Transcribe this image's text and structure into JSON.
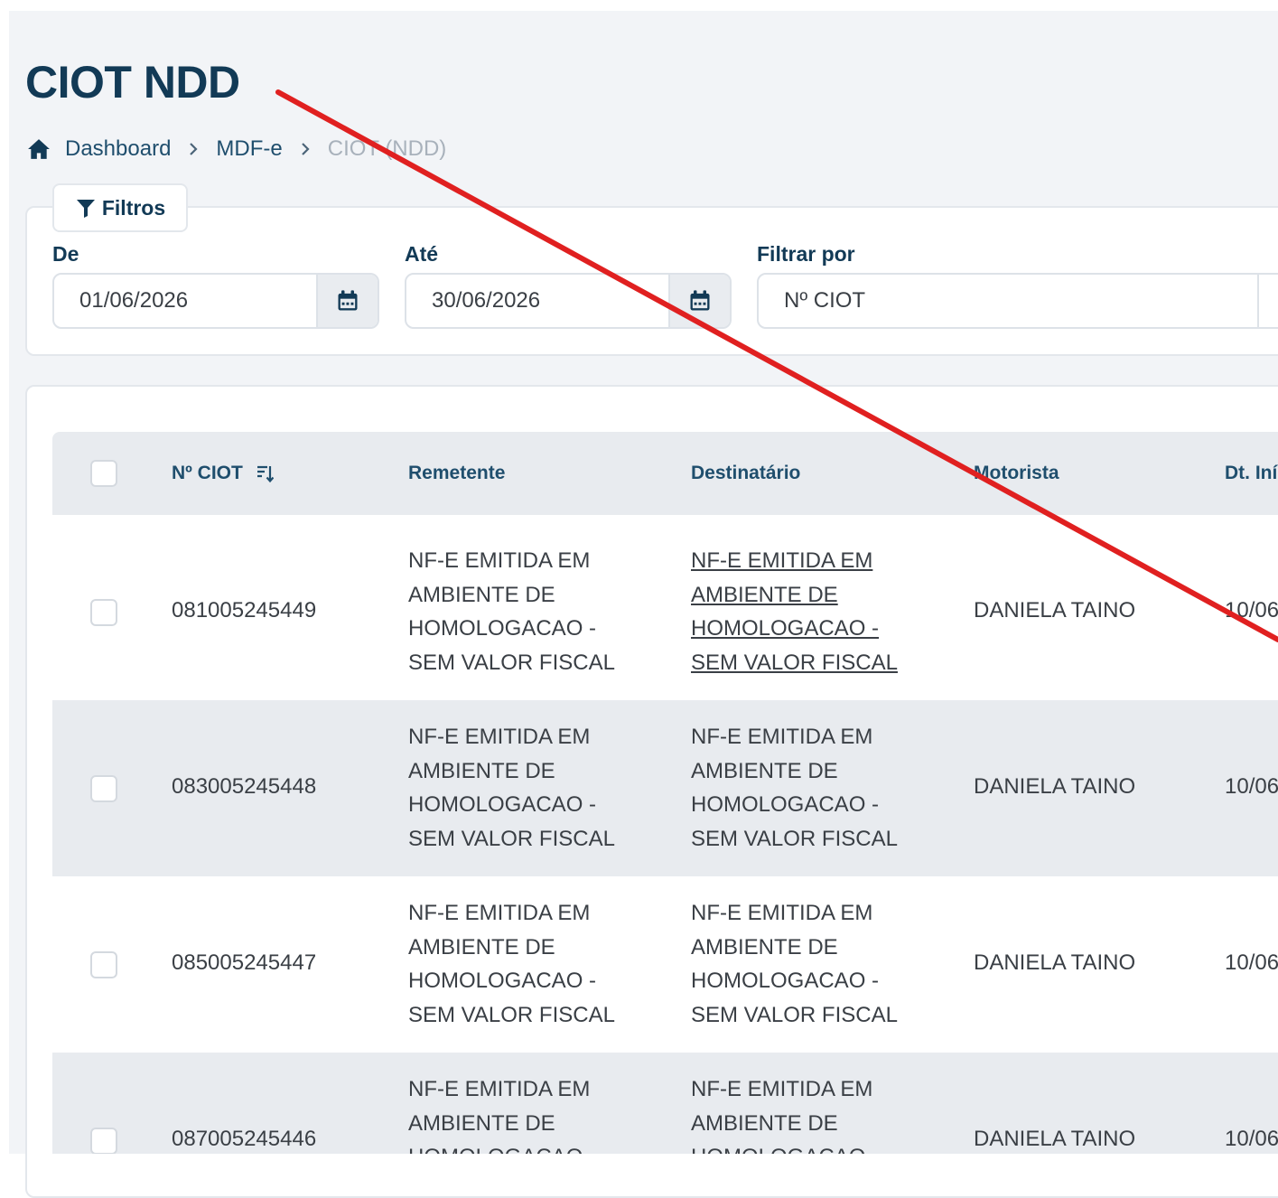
{
  "page": {
    "title": "CIOT NDD",
    "breadcrumb": {
      "items": [
        "Dashboard",
        "MDF-e"
      ],
      "current": "CIOT (NDD)"
    }
  },
  "filters": {
    "tab_label": "Filtros",
    "de": {
      "label": "De",
      "value": "01/06/2026"
    },
    "ate": {
      "label": "Até",
      "value": "30/06/2026"
    },
    "filtrar_por": {
      "label": "Filtrar por",
      "value": "Nº CIOT"
    }
  },
  "table": {
    "columns": {
      "ciot": "Nº CIOT",
      "remetente": "Remetente",
      "destinatario": "Destinatário",
      "motorista": "Motorista",
      "dt_inicio": "Dt. Iní"
    },
    "rows": [
      {
        "ciot": "081005245449",
        "remetente": "NF-E EMITIDA EM AMBIENTE DE HOMOLOGACAO - SEM VALOR FISCAL",
        "destinatario": "NF-E EMITIDA EM AMBIENTE DE HOMOLOGACAO - SEM VALOR FISCAL",
        "motorista": "DANIELA TAINO",
        "dt_inicio": "10/06"
      },
      {
        "ciot": "083005245448",
        "remetente": "NF-E EMITIDA EM AMBIENTE DE HOMOLOGACAO - SEM VALOR FISCAL",
        "destinatario": "NF-E EMITIDA EM AMBIENTE DE HOMOLOGACAO - SEM VALOR FISCAL",
        "motorista": "DANIELA TAINO",
        "dt_inicio": "10/06"
      },
      {
        "ciot": "085005245447",
        "remetente": "NF-E EMITIDA EM AMBIENTE DE HOMOLOGACAO - SEM VALOR FISCAL",
        "destinatario": "NF-E EMITIDA EM AMBIENTE DE HOMOLOGACAO - SEM VALOR FISCAL",
        "motorista": "DANIELA TAINO",
        "dt_inicio": "10/06"
      },
      {
        "ciot": "087005245446",
        "remetente": "NF-E EMITIDA EM AMBIENTE DE HOMOLOGACAO - SEM VALOR FISCAL",
        "destinatario": "NF-E EMITIDA EM AMBIENTE DE HOMOLOGACAO - SEM VALOR FISCAL",
        "motorista": "DANIELA TAINO",
        "dt_inicio": "10/06"
      }
    ]
  },
  "colors": {
    "primary_text": "#123a56",
    "link": "#1f4e6d",
    "page_bg": "#f2f4f7",
    "stripe": "#e8ebef",
    "annotation_line": "#e02020"
  },
  "icons": {
    "home": "home-icon",
    "chevron": "chevron-right-icon",
    "filter": "filter-icon",
    "calendar": "calendar-icon",
    "sort": "sort-icon",
    "checkbox": "checkbox"
  }
}
